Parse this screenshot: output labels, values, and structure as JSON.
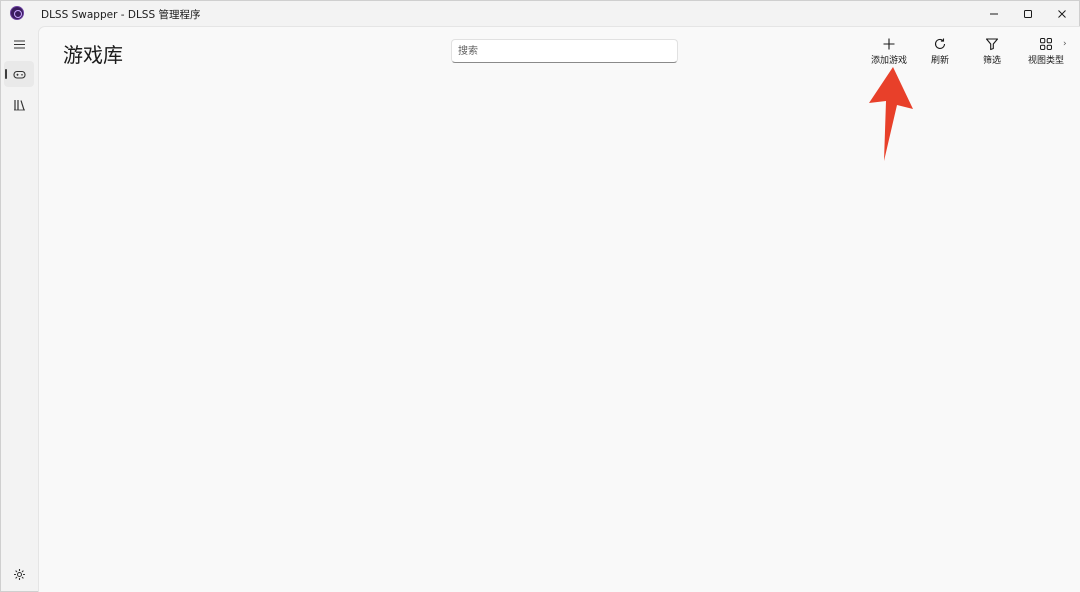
{
  "window": {
    "title": "DLSS Swapper - DLSS 管理程序",
    "controls": [
      "minimize",
      "maximize",
      "close"
    ]
  },
  "nav": {
    "items": [
      {
        "name": "menu",
        "icon": "hamburger-icon"
      },
      {
        "name": "games",
        "icon": "gamepad-icon",
        "selected": true
      },
      {
        "name": "library",
        "icon": "library-icon"
      },
      {
        "name": "settings",
        "icon": "gear-icon"
      }
    ]
  },
  "page": {
    "title": "游戏库",
    "search": {
      "placeholder": "搜索",
      "value": ""
    }
  },
  "commands": {
    "add_game": "添加游戏",
    "refresh": "刷新",
    "filter": "筛选",
    "view_type": "视图类型"
  },
  "annotation": {
    "arrow_color": "#e8402a",
    "target": "add_game"
  },
  "colors": {
    "content_bg": "#f9f9f9",
    "chrome_bg": "#f3f3f3"
  }
}
